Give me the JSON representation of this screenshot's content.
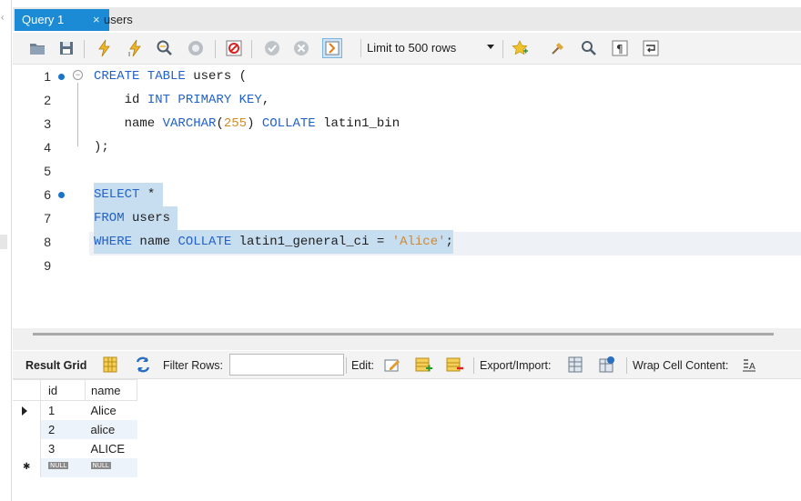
{
  "tabs": [
    {
      "label": "Query 1",
      "active": true,
      "close": "×"
    },
    {
      "label": "users",
      "active": false
    }
  ],
  "toolbar": {
    "icons": [
      "open-folder-icon",
      "save-icon",
      "execute-icon",
      "execute-current-icon",
      "explain-icon",
      "stop-icon",
      "toggle-results-icon",
      "commit-icon",
      "rollback-icon",
      "autocommit-icon",
      "bookmark-star-icon",
      "beautify-icon",
      "find-icon",
      "invisible-chars-icon",
      "wrap-lines-icon"
    ],
    "limit_label": "Limit to 500 rows"
  },
  "editor": {
    "lines": [
      {
        "n": "1",
        "tokens": [
          [
            "kw",
            "CREATE TABLE "
          ],
          [
            "id",
            "users ("
          ]
        ]
      },
      {
        "n": "2",
        "tokens": [
          [
            "id",
            "    id "
          ],
          [
            "kw",
            "INT PRIMARY KEY"
          ],
          [
            "id",
            ","
          ]
        ]
      },
      {
        "n": "3",
        "tokens": [
          [
            "id",
            "    name "
          ],
          [
            "kw",
            "VARCHAR"
          ],
          [
            "id",
            "("
          ],
          [
            "num",
            "255"
          ],
          [
            "id",
            ") "
          ],
          [
            "kw",
            "COLLATE "
          ],
          [
            "id",
            "latin1_bin"
          ]
        ]
      },
      {
        "n": "4",
        "tokens": [
          [
            "id",
            ");"
          ]
        ]
      },
      {
        "n": "5",
        "tokens": []
      },
      {
        "n": "6",
        "tokens": [
          [
            "kw",
            "SELECT "
          ],
          [
            "id",
            "* "
          ]
        ]
      },
      {
        "n": "7",
        "tokens": [
          [
            "kw",
            "FROM "
          ],
          [
            "id",
            "users "
          ]
        ]
      },
      {
        "n": "8",
        "tokens": [
          [
            "kw",
            "WHERE "
          ],
          [
            "id",
            "name "
          ],
          [
            "kw",
            "COLLATE "
          ],
          [
            "id",
            "latin1_general_ci = "
          ],
          [
            "str",
            "'Alice'"
          ],
          [
            "id",
            ";"
          ]
        ]
      },
      {
        "n": "9",
        "tokens": []
      }
    ]
  },
  "result_toolbar": {
    "result_grid": "Result Grid",
    "filter_rows": "Filter Rows:",
    "filter_value": "",
    "edit": "Edit:",
    "export_import": "Export/Import:",
    "wrap_cell": "Wrap Cell Content:"
  },
  "grid": {
    "columns": [
      "id",
      "name"
    ],
    "rows": [
      {
        "id": "1",
        "name": "Alice"
      },
      {
        "id": "2",
        "name": "alice"
      },
      {
        "id": "3",
        "name": "ALICE"
      }
    ],
    "null_label": "NULL"
  },
  "colors": {
    "accent": "#1a8bd4",
    "keyword": "#2262c9",
    "selection": "#c7ddf0",
    "number": "#d28a2a"
  }
}
